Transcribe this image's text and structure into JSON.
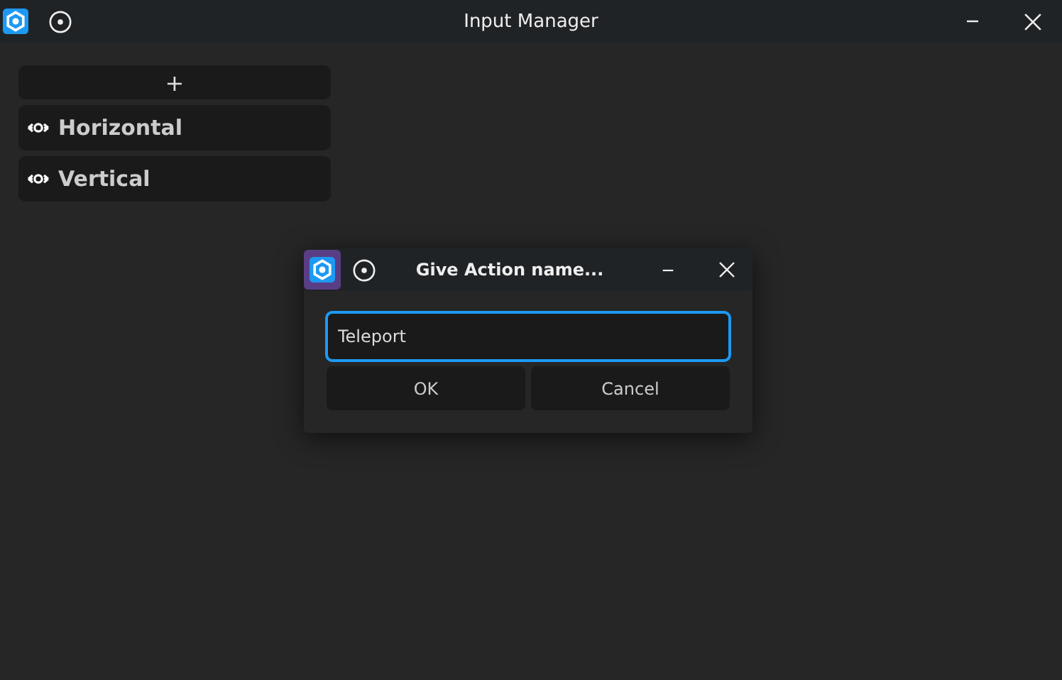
{
  "window": {
    "title": "Input Manager"
  },
  "actions": {
    "add_label": "+",
    "items": [
      {
        "label": "Horizontal"
      },
      {
        "label": "Vertical"
      }
    ]
  },
  "dialog": {
    "title": "Give Action name...",
    "value": "Teleport",
    "buttons": [
      {
        "label": "OK"
      },
      {
        "label": "Cancel"
      }
    ]
  }
}
